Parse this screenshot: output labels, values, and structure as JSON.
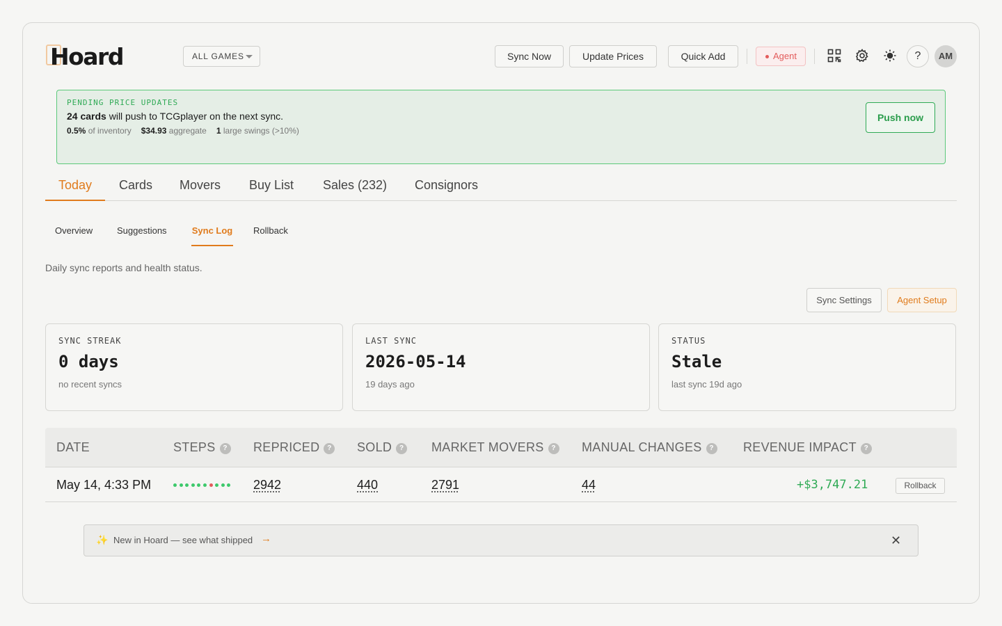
{
  "app": {
    "name": "Hoard"
  },
  "header": {
    "game_filter": "ALL GAMES",
    "sync_now": "Sync Now",
    "update_prices": "Update Prices",
    "quick_add": "Quick Add",
    "agent": "Agent",
    "help": "?",
    "avatar_initials": "AM",
    "icons": [
      "qr-code-icon",
      "gear-icon",
      "sun-icon"
    ]
  },
  "banner": {
    "label": "PENDING PRICE UPDATES",
    "count": "24 cards",
    "message": " will push to TCGplayer on the next sync.",
    "pct": "0.5%",
    "pct_label": " of inventory",
    "aggregate": "$34.93",
    "aggregate_label": " aggregate",
    "swings": "1",
    "swings_label": " large swings (>10%)",
    "push": "Push now"
  },
  "tabs": [
    "Today",
    "Cards",
    "Movers",
    "Buy List",
    "Sales (232)",
    "Consignors"
  ],
  "active_tab": "Today",
  "subtabs": [
    "Overview",
    "Suggestions",
    "Sync Log",
    "Rollback"
  ],
  "active_subtab": "Sync Log",
  "description": "Daily sync reports and health status.",
  "actions": {
    "sync_settings": "Sync Settings",
    "agent_setup": "Agent Setup"
  },
  "cards": [
    {
      "key": "SYNC STREAK",
      "value": "0 days",
      "sub": "no recent syncs"
    },
    {
      "key": "LAST SYNC",
      "value": "2026-05-14",
      "sub": "19 days ago"
    },
    {
      "key": "STATUS",
      "value": "Stale",
      "sub": "last sync 19d ago"
    }
  ],
  "table": {
    "headers": [
      "DATE",
      "STEPS",
      "REPRICED",
      "SOLD",
      "MARKET MOVERS",
      "MANUAL CHANGES",
      "REVENUE IMPACT"
    ],
    "rows": [
      {
        "date": "May 14, 4:33 PM",
        "steps": [
          "ok",
          "ok",
          "ok",
          "ok",
          "ok",
          "ok",
          "bad",
          "ok",
          "ok",
          "ok"
        ],
        "repriced": "2942",
        "sold": "440",
        "market_movers": "2791",
        "manual_changes": "44",
        "revenue_impact": "+$3,747.21",
        "action": "Rollback"
      }
    ]
  },
  "toast": {
    "text": "New in Hoard — see what shipped",
    "arrow": "→",
    "close": "✕",
    "spark": "✨"
  },
  "colors": {
    "accent": "#e07b1c",
    "success": "#2faa55",
    "danger": "#e35b5b"
  }
}
